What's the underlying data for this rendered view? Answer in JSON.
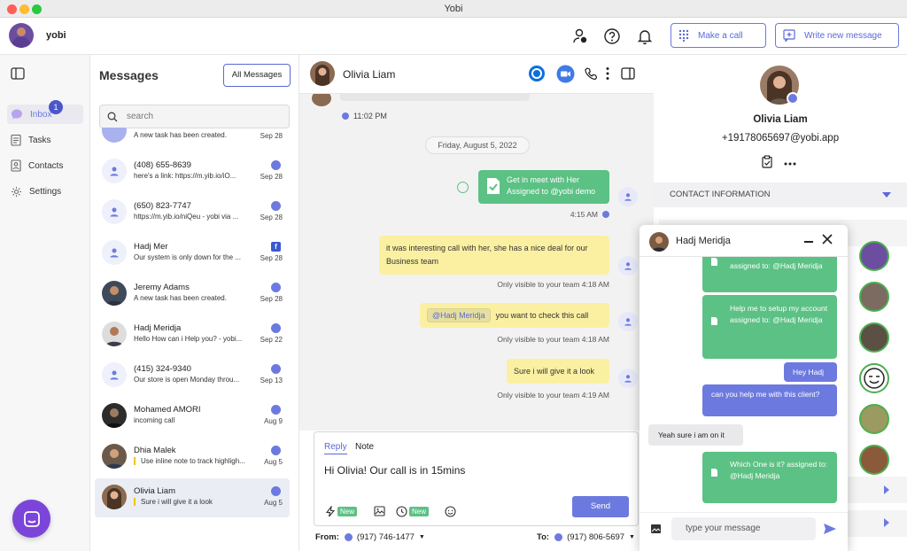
{
  "window": {
    "title": "Yobi"
  },
  "topbar": {
    "username": "yobi",
    "make_call_label": "Make a call",
    "write_message_label": "Write new message"
  },
  "nav": {
    "items": [
      {
        "label": "Inbox",
        "badge": "1"
      },
      {
        "label": "Tasks"
      },
      {
        "label": "Contacts"
      },
      {
        "label": "Settings"
      }
    ]
  },
  "messages": {
    "title": "Messages",
    "filter_label": "All Messages",
    "search_placeholder": "search",
    "conversations": [
      {
        "name": "",
        "preview": "A new task has been created.",
        "date": "Sep 28",
        "channel": "chat"
      },
      {
        "name": "(408) 655-8639",
        "preview": "here's a link: https://m.yib.io/iO...",
        "date": "Sep 28",
        "channel": "chat"
      },
      {
        "name": "(650) 823-7747",
        "preview": "https://m.yib.io/niQeu - yobi via ...",
        "date": "Sep 28",
        "channel": "chat"
      },
      {
        "name": "Hadj Mer",
        "preview": "Our system is only down for the ...",
        "date": "Sep 28",
        "channel": "facebook"
      },
      {
        "name": "Jeremy Adams",
        "preview": "A new task has been created.",
        "date": "Sep 28",
        "channel": "chat"
      },
      {
        "name": "Hadj Meridja",
        "preview": "Hello How can i Help you? - yobi...",
        "date": "Sep 22",
        "channel": "chat"
      },
      {
        "name": "(415) 324-9340",
        "preview": "Our store is open Monday throu...",
        "date": "Sep 13",
        "channel": "chat"
      },
      {
        "name": "Mohamed AMORI",
        "preview": "incoming call",
        "date": "Aug 9",
        "channel": "chat"
      },
      {
        "name": "Dhia Malek",
        "preview": "Use inline note to track highligh...",
        "date": "Aug 5",
        "channel": "chat"
      },
      {
        "name": "Olivia Liam",
        "preview": "Sure i will give it a look",
        "date": "Aug 5",
        "channel": "chat"
      }
    ]
  },
  "chat": {
    "contact_name": "Olivia Liam",
    "top_time": "11:02 PM",
    "date_divider": "Friday, August 5, 2022",
    "task_line1": "Get in meet with Her",
    "task_line2": "Assigned to @yobi demo",
    "task_time": "4:15 AM",
    "note1": "it was interesting call with her, she has a nice deal for our Business team",
    "note1_meta": "Only visible to your team   4:18 AM",
    "note2_mention": "@Hadj Meridja",
    "note2_text": "you want to check this call",
    "note2_meta": "Only visible to your team   4:18 AM",
    "note3": "Sure i will give it a look",
    "note3_meta": "Only visible to your team   4:19 AM",
    "composer": {
      "tab_reply": "Reply",
      "tab_note": "Note",
      "text": "Hi Olivia! Our call is in 15mins",
      "new_tag": "New",
      "send_label": "Send"
    },
    "from_label": "From:",
    "from_number": "(917) 746-1477",
    "to_label": "To:",
    "to_number": "(917) 806-5697"
  },
  "contact": {
    "name": "Olivia Liam",
    "phone": "+19178065697@yobi.app",
    "section_title": "CONTACT INFORMATION"
  },
  "popup": {
    "name": "Hadj Meridja",
    "m1": "assigned to: @Hadj Meridja",
    "m2": "Help me to setup my account assigned to: @Hadj Meridja",
    "m3": "Hey Hadj",
    "m4": "can you help me with this client?",
    "m5": "Yeah sure i am on it",
    "m6": "Which One is it? assigned to: @Hadj Meridja",
    "input_placeholder": "type your message"
  },
  "colors": {
    "accent": "#6c7ae0",
    "task_green": "#5cc184",
    "note_yellow": "#fbf0a2"
  }
}
